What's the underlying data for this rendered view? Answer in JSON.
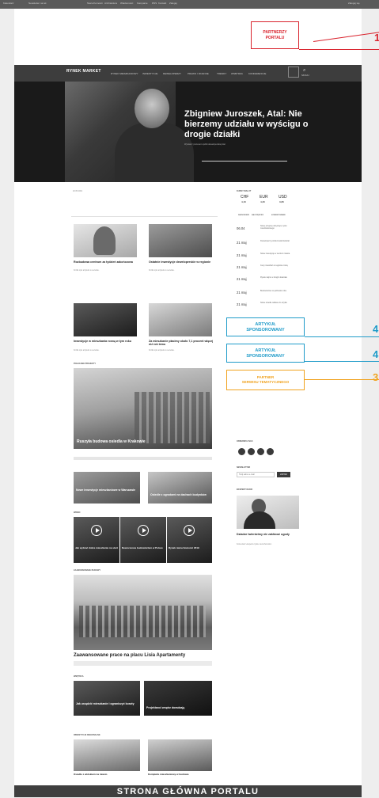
{
  "top_strip": {
    "items": [
      "Kalendarz",
      "Newsletter na tel.",
      "Nieruchomości",
      "Architektura",
      "Wiadomości",
      "Kampanie",
      "RSS",
      "Kontakt",
      "Zaloguj"
    ],
    "right": "Zaloguj się"
  },
  "nav": {
    "logo": "RYNEK MARKET",
    "items": [
      "RYNEK MIESZKANIOWY",
      "INWESTYCJE",
      "DEWELOPERZY",
      "PRAWO I FINANSE",
      "TRENDY",
      "WNĘTRZA",
      "KONFERENCJE"
    ],
    "search": "SZUKAJ"
  },
  "hero": {
    "title": "Zbigniew Juroszek, Atal: Nie bierzemy udziału w wyścigu o drogie działki",
    "lead": "Wywiad z prezesem spółki deweloperskiej Atal."
  },
  "callouts": {
    "partners": "PARTNERZY\nPORTALU",
    "partners_num": "1",
    "sponsored1": "ARTYKUŁ\nSPONSOROWANY",
    "sponsored1_num": "4",
    "sponsored2": "ARTYKUŁ\nSPONSOROWANY",
    "sponsored2_num": "4",
    "partner_theme": "PARTNER\nSERWISU TEMATYCZNEGO",
    "partner_theme_num": "3"
  },
  "main": {
    "date_label": "20.05.2019",
    "articles": [
      {
        "title": "Rozbudowa centrum za tydzień zakończona",
        "lead": "Krótki opis artykułu w serwisie."
      },
      {
        "title": "Ostatnie inwestycje deweloperskie w regionie",
        "lead": "Krótki opis artykułu w serwisie."
      },
      {
        "title": "Inwestycje w mieszkania rosną w tym roku",
        "lead": "Krótki opis artykułu w serwisie."
      },
      {
        "title": "Za mieszkanie płacimy około 7,1 procent więcej niż rok temu",
        "lead": "Krótki opis artykułu w serwisie."
      }
    ],
    "section_featured": "POLECANE PROJEKTY",
    "featured_title": "Ruszyła budowa osiedla w Krakowie",
    "small_features": [
      "Nowe inwestycje mieszkaniowe w Warszawie",
      "Osiedle z ogrodami na dachach budynków"
    ],
    "section_video": "WIDEO",
    "videos": [
      "Jak wybrać dobre mieszkanie na start",
      "Nowoczesne budownictwo w Polsce",
      "Rynek nieruchomości 2019"
    ],
    "section_apartments": "ZAAWANSOWANE BUDOWY",
    "apartments_title": "Zaawansowane prace na placu Lisia Apartamenty",
    "section_interiors": "WNĘTRZA",
    "interiors": [
      "Jak urządzić mieszkanie i ograniczyć koszty",
      "Projektanci wnętrz doradzają"
    ],
    "section_investments": "INWESTYCJE REGIONALNE",
    "investments": [
      "Osiedle z widokiem na miasto",
      "Kompleks mieszkaniowy w budowie"
    ]
  },
  "sidebar": {
    "currency_title": "KURSY WALUT",
    "currencies": [
      {
        "code": "CHF",
        "value": "4,16"
      },
      {
        "code": "EUR",
        "value": "4,30"
      },
      {
        "code": "USD",
        "value": "3,86"
      }
    ],
    "news_tabs": [
      "NAJNOWSZE",
      "NAJCZĘŚCIEJ",
      "KOMENTOWANE"
    ],
    "news": [
      {
        "date": "06.04",
        "text": "Nowe przepisy dotyczące rynku mieszkaniowego"
      },
      {
        "date": "21 maj",
        "text": "Deweloperzy podsumowali kwartał"
      },
      {
        "date": "21 maj",
        "text": "Nowe inwestycje w centrum miasta"
      },
      {
        "date": "21 maj",
        "text": "Ceny mieszkań w regionie rosną"
      },
      {
        "date": "21 maj",
        "text": "Rynek najmu w drugim kwartale"
      },
      {
        "date": "21 maj",
        "text": "Budownictwo na półmetku roku"
      },
      {
        "date": "21 maj",
        "text": "Nowe osiedle oddane do użytku"
      }
    ],
    "social_title": "OBSERWUJ NAS",
    "newsletter_title": "NEWSLETTER",
    "newsletter_placeholder": "Twój adres e-mail",
    "newsletter_button": "ZAPISZ",
    "expert_title": "EKSPERT RADZI",
    "expert_article_title": "Dziadze twierdzimy nie zakłócać ugody",
    "expert_article_lead": "Komentarz eksperta rynku nieruchomości."
  },
  "caption": "STRONA GŁÓWNA PORTALU"
}
